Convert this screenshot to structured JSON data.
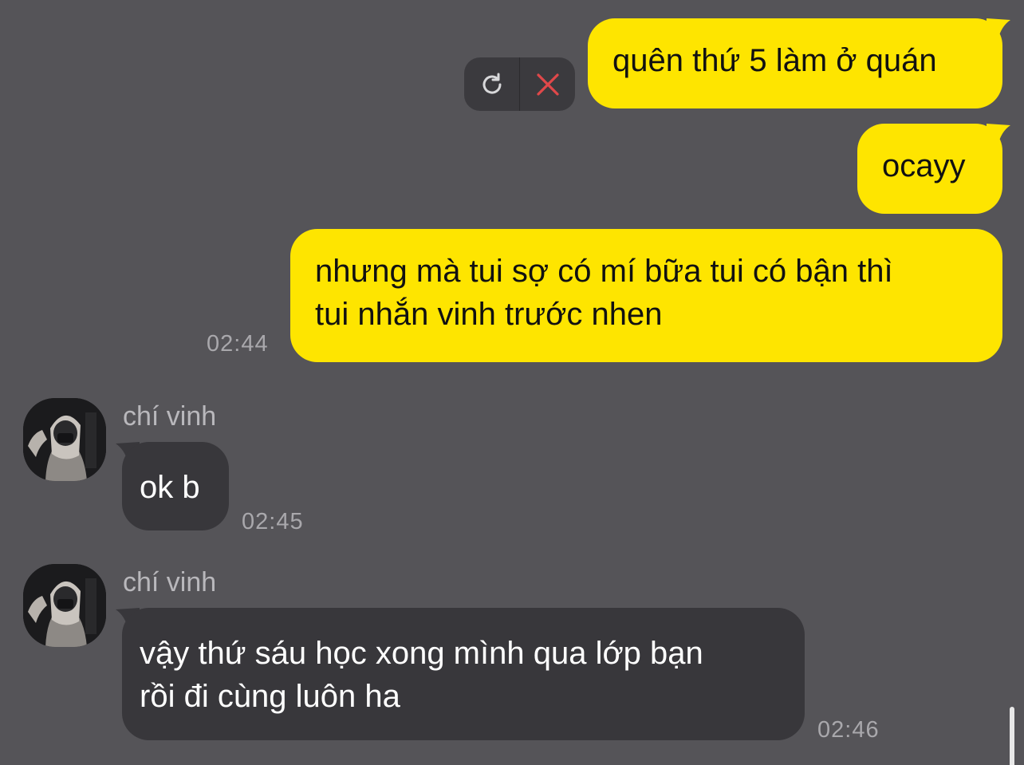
{
  "colors": {
    "background": "#555458",
    "my_bubble": "#fee500",
    "their_bubble": "#38373b",
    "timestamp": "#a9a8ac",
    "failed_x": "#e0484a"
  },
  "pending": {
    "retry_icon": "refresh-icon",
    "delete_icon": "close-icon"
  },
  "messages": {
    "m1": {
      "text": "quên thứ 5 làm ở quán"
    },
    "m2": {
      "text": "ocayy"
    },
    "m3": {
      "line1": "nhưng mà tui sợ có mí bữa tui có bận thì",
      "line2": "tui nhắn vinh trước nhen",
      "time": "02:44"
    },
    "m4": {
      "sender": "chí vinh",
      "text": "ok b",
      "time": "02:45"
    },
    "m5": {
      "sender": "chí vinh",
      "line1": "vậy thứ sáu học xong mình qua lớp bạn",
      "line2": "rồi đi cùng luôn ha",
      "time": "02:46"
    }
  }
}
